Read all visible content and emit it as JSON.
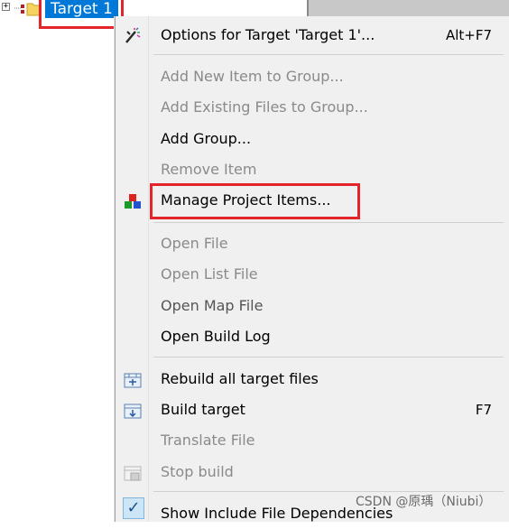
{
  "tree": {
    "expander": "+",
    "target_label": "Target 1"
  },
  "menu": {
    "options_label": "Options for Target 'Target 1'...",
    "options_shortcut": "Alt+F7",
    "add_new_item": "Add New Item to Group...",
    "add_existing_files": "Add Existing Files to Group...",
    "add_group": "Add Group...",
    "remove_item": "Remove Item",
    "manage_project_items": "Manage Project Items...",
    "open_file": "Open File",
    "open_list_file": "Open List File",
    "open_map_file": "Open Map File",
    "open_build_log": "Open Build Log",
    "rebuild_all": "Rebuild all target files",
    "build_target": "Build target",
    "build_target_shortcut": "F7",
    "translate_file": "Translate File",
    "stop_build": "Stop build",
    "show_include_deps": "Show Include File Dependencies",
    "check_mark": "✓"
  },
  "watermark": "CSDN @原瑀（Niubi）",
  "colors": {
    "highlight_red": "#e3242b",
    "selection_blue": "#0078d7",
    "menu_bg": "#f0f0f0",
    "disabled_text": "#8a8a8a"
  }
}
